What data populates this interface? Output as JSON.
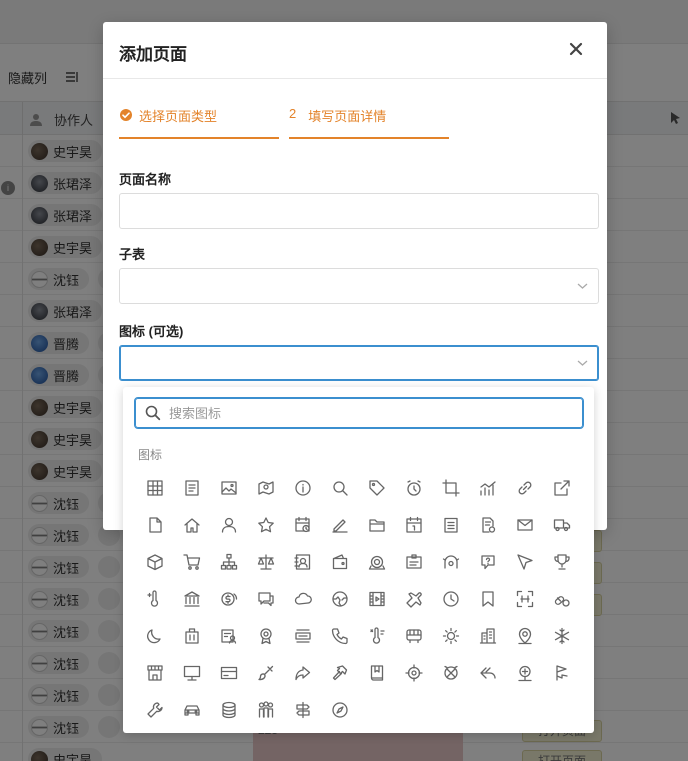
{
  "background": {
    "toolbar": {
      "hidden_columns": "隐藏列"
    },
    "table": {
      "collaborator_header": "协作人",
      "rows": [
        {
          "name": "史宇昊",
          "avatar": "a1",
          "extra": false
        },
        {
          "name": "张珺泽",
          "avatar": "a2",
          "extra": false
        },
        {
          "name": "张珺泽",
          "avatar": "a2",
          "extra": false
        },
        {
          "name": "史宇昊",
          "avatar": "a1",
          "extra": false
        },
        {
          "name": "沈钰",
          "avatar": "a3",
          "extra": true
        },
        {
          "name": "张珺泽",
          "avatar": "a2",
          "extra": false
        },
        {
          "name": "晋腾",
          "avatar": "a4",
          "extra": true
        },
        {
          "name": "晋腾",
          "avatar": "a4",
          "extra": true
        },
        {
          "name": "史宇昊",
          "avatar": "a1",
          "extra": false
        },
        {
          "name": "史宇昊",
          "avatar": "a1",
          "extra": false
        },
        {
          "name": "史宇昊",
          "avatar": "a1",
          "extra": false
        },
        {
          "name": "沈钰",
          "avatar": "a3",
          "extra": true
        },
        {
          "name": "沈钰",
          "avatar": "a3",
          "extra": true
        },
        {
          "name": "沈钰",
          "avatar": "a3",
          "extra": true
        },
        {
          "name": "沈钰",
          "avatar": "a3",
          "extra": true
        },
        {
          "name": "沈钰",
          "avatar": "a3",
          "extra": true
        },
        {
          "name": "沈钰",
          "avatar": "a3",
          "extra": true
        },
        {
          "name": "沈钰",
          "avatar": "a3",
          "extra": true
        },
        {
          "name": "沈钰",
          "avatar": "a3",
          "extra": true
        },
        {
          "name": "史宇昊",
          "avatar": "a1",
          "extra": false
        }
      ],
      "cell_value": "225",
      "open_page_button": "打开页面"
    }
  },
  "dialog": {
    "title": "添加页面",
    "steps": [
      {
        "label": "选择页面类型",
        "done": true
      },
      {
        "number": "2",
        "label": "填写页面详情",
        "done": false
      }
    ],
    "fields": {
      "page_name": {
        "label": "页面名称",
        "value": "",
        "placeholder": ""
      },
      "subtable": {
        "label": "子表",
        "value": ""
      },
      "icon": {
        "label": "图标 (可选)",
        "value": ""
      }
    }
  },
  "icon_picker": {
    "search_placeholder": "搜索图标",
    "group_label": "图标",
    "icons": [
      "table",
      "document",
      "image",
      "map-pin",
      "info",
      "search",
      "tag",
      "alarm",
      "crop",
      "chart",
      "link",
      "external-link",
      "file",
      "home",
      "user",
      "star",
      "calendar-clock",
      "edit",
      "folder",
      "calendar",
      "clipboard",
      "file-settings",
      "mail",
      "truck",
      "box",
      "cart",
      "org-chart",
      "scale",
      "contact",
      "wallet",
      "support",
      "id-card",
      "face",
      "chat-question",
      "cursor",
      "trophy",
      "thermo-plus",
      "bank",
      "coin",
      "chat",
      "cloud",
      "globe",
      "film",
      "plane",
      "clock",
      "bookmark",
      "scan",
      "pills",
      "moon",
      "luggage",
      "id-user",
      "badge",
      "printer",
      "phone",
      "thermometer",
      "bus",
      "sun",
      "building",
      "location",
      "snowflake",
      "store",
      "monitor",
      "card",
      "brush",
      "share",
      "hammer",
      "book",
      "target",
      "compass-alt",
      "undo",
      "award",
      "flag",
      "wrench",
      "car",
      "database",
      "people",
      "signpost",
      "compass"
    ]
  }
}
